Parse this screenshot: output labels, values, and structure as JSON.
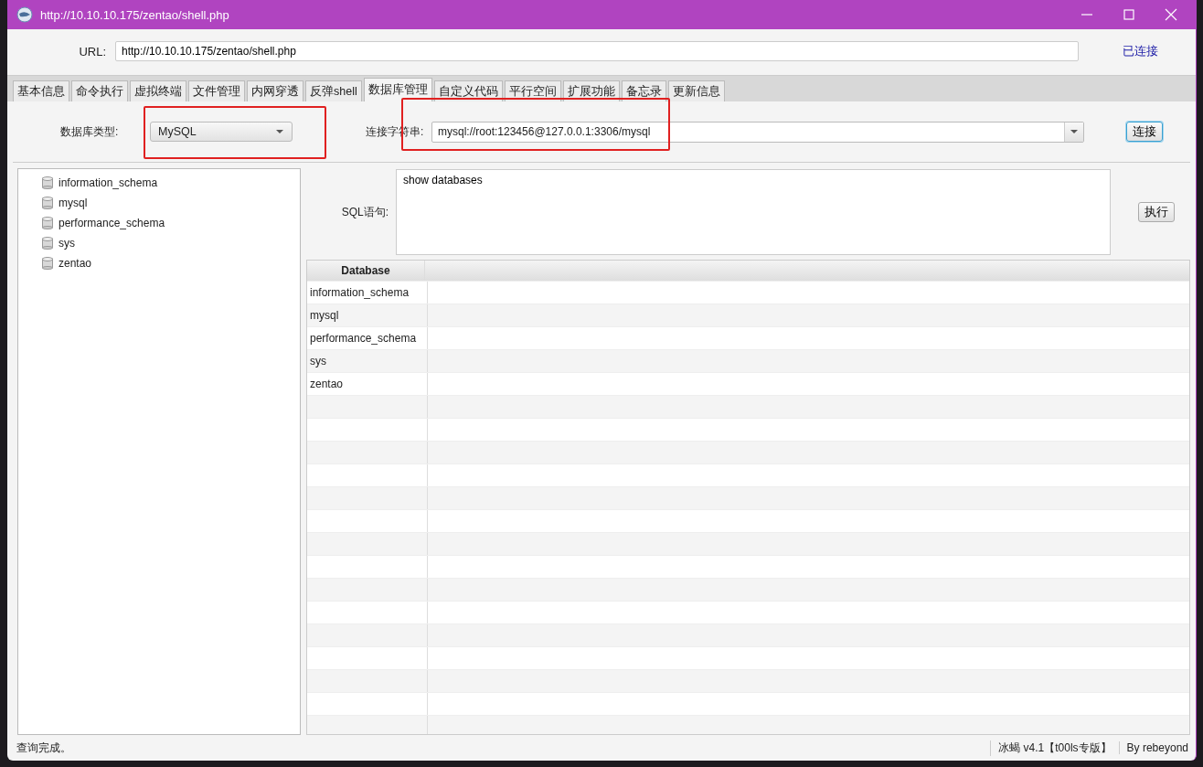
{
  "window": {
    "title": "http://10.10.10.175/zentao/shell.php"
  },
  "url": {
    "label": "URL:",
    "value": "http://10.10.10.175/zentao/shell.php",
    "status": "已连接"
  },
  "tabs": [
    {
      "label": "基本信息",
      "selected": false
    },
    {
      "label": "命令执行",
      "selected": false
    },
    {
      "label": "虚拟终端",
      "selected": false
    },
    {
      "label": "文件管理",
      "selected": false
    },
    {
      "label": "内网穿透",
      "selected": false
    },
    {
      "label": "反弹shell",
      "selected": false
    },
    {
      "label": "数据库管理",
      "selected": true
    },
    {
      "label": "自定义代码",
      "selected": false
    },
    {
      "label": "平行空间",
      "selected": false
    },
    {
      "label": "扩展功能",
      "selected": false
    },
    {
      "label": "备忘录",
      "selected": false
    },
    {
      "label": "更新信息",
      "selected": false
    }
  ],
  "db_form": {
    "type_label": "数据库类型:",
    "type_value": "MySQL",
    "conn_label": "连接字符串:",
    "conn_value": "mysql://root:123456@127.0.0.1:3306/mysql",
    "connect_button": "连接"
  },
  "tree": {
    "items": [
      {
        "label": "information_schema"
      },
      {
        "label": "mysql"
      },
      {
        "label": "performance_schema"
      },
      {
        "label": "sys"
      },
      {
        "label": "zentao"
      }
    ]
  },
  "sql": {
    "label": "SQL语句:",
    "value": "show databases",
    "run_button": "执行"
  },
  "table": {
    "columns": [
      "Database"
    ],
    "rows": [
      [
        "information_schema"
      ],
      [
        "mysql"
      ],
      [
        "performance_schema"
      ],
      [
        "sys"
      ],
      [
        "zentao"
      ]
    ]
  },
  "status_bar": {
    "message": "查询完成。",
    "version": "冰蝎 v4.1【t00ls专版】",
    "author": "By rebeyond"
  }
}
